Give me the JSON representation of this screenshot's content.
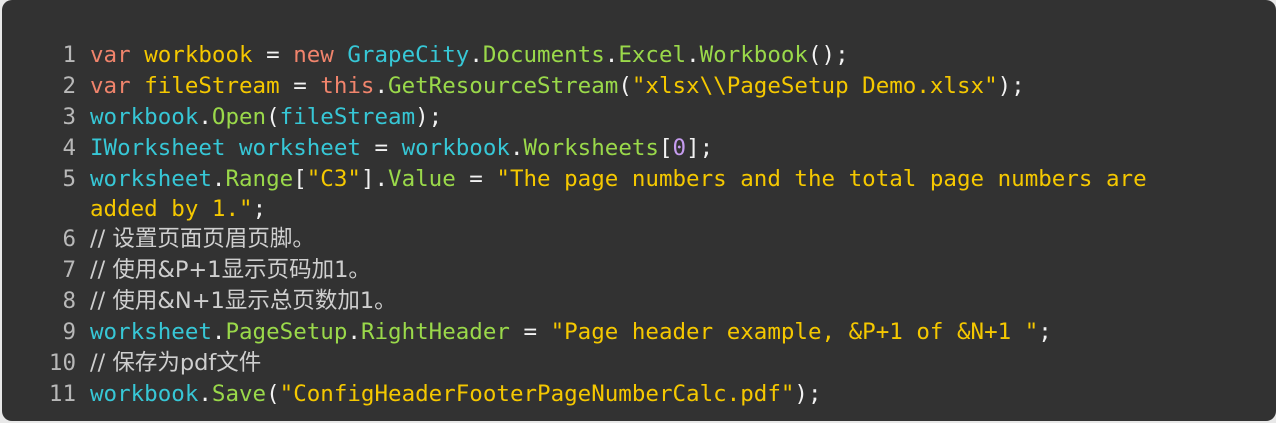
{
  "code": {
    "line_numbers": [
      "1",
      "2",
      "3",
      "4",
      "5",
      "6",
      "7",
      "8",
      "9",
      "10",
      "11"
    ],
    "lines": [
      [
        {
          "t": "k",
          "v": "var"
        },
        {
          "t": "p",
          "v": " "
        },
        {
          "t": "v",
          "v": "workbook"
        },
        {
          "t": "p",
          "v": " = "
        },
        {
          "t": "k",
          "v": "new"
        },
        {
          "t": "p",
          "v": " "
        },
        {
          "t": "c",
          "v": "GrapeCity"
        },
        {
          "t": "p",
          "v": "."
        },
        {
          "t": "m",
          "v": "Documents"
        },
        {
          "t": "p",
          "v": "."
        },
        {
          "t": "m",
          "v": "Excel"
        },
        {
          "t": "p",
          "v": "."
        },
        {
          "t": "m",
          "v": "Workbook"
        },
        {
          "t": "p",
          "v": "();"
        }
      ],
      [
        {
          "t": "k",
          "v": "var"
        },
        {
          "t": "p",
          "v": " "
        },
        {
          "t": "v",
          "v": "fileStream"
        },
        {
          "t": "p",
          "v": " = "
        },
        {
          "t": "k",
          "v": "this"
        },
        {
          "t": "p",
          "v": "."
        },
        {
          "t": "m",
          "v": "GetResourceStream"
        },
        {
          "t": "p",
          "v": "("
        },
        {
          "t": "s",
          "v": "\"xlsx\\\\PageSetup Demo.xlsx\""
        },
        {
          "t": "p",
          "v": ");"
        }
      ],
      [
        {
          "t": "c",
          "v": "workbook"
        },
        {
          "t": "p",
          "v": "."
        },
        {
          "t": "m",
          "v": "Open"
        },
        {
          "t": "p",
          "v": "("
        },
        {
          "t": "c",
          "v": "fileStream"
        },
        {
          "t": "p",
          "v": ");"
        }
      ],
      [
        {
          "t": "c",
          "v": "IWorksheet"
        },
        {
          "t": "p",
          "v": " "
        },
        {
          "t": "c",
          "v": "worksheet"
        },
        {
          "t": "p",
          "v": " = "
        },
        {
          "t": "c",
          "v": "workbook"
        },
        {
          "t": "p",
          "v": "."
        },
        {
          "t": "m",
          "v": "Worksheets"
        },
        {
          "t": "p",
          "v": "["
        },
        {
          "t": "n",
          "v": "0"
        },
        {
          "t": "p",
          "v": "];"
        }
      ],
      [
        {
          "t": "c",
          "v": "worksheet"
        },
        {
          "t": "p",
          "v": "."
        },
        {
          "t": "m",
          "v": "Range"
        },
        {
          "t": "p",
          "v": "["
        },
        {
          "t": "s",
          "v": "\"C3\""
        },
        {
          "t": "p",
          "v": "]."
        },
        {
          "t": "m",
          "v": "Value"
        },
        {
          "t": "p",
          "v": " = "
        },
        {
          "t": "s",
          "v": "\"The page numbers and the total page numbers are added by 1.\""
        },
        {
          "t": "p",
          "v": ";"
        }
      ],
      [
        {
          "t": "cm",
          "v": "// 设置页面页眉页脚。"
        }
      ],
      [
        {
          "t": "cm",
          "v": "// 使用&P+1显示页码加1。"
        }
      ],
      [
        {
          "t": "cm",
          "v": "// 使用&N+1显示总页数加1。"
        }
      ],
      [
        {
          "t": "c",
          "v": "worksheet"
        },
        {
          "t": "p",
          "v": "."
        },
        {
          "t": "m",
          "v": "PageSetup"
        },
        {
          "t": "p",
          "v": "."
        },
        {
          "t": "m",
          "v": "RightHeader"
        },
        {
          "t": "p",
          "v": " = "
        },
        {
          "t": "s",
          "v": "\"Page header example, &P+1 of &N+1 \""
        },
        {
          "t": "p",
          "v": ";"
        }
      ],
      [
        {
          "t": "cm",
          "v": "// 保存为pdf文件"
        }
      ],
      [
        {
          "t": "c",
          "v": "workbook"
        },
        {
          "t": "p",
          "v": "."
        },
        {
          "t": "m",
          "v": "Save"
        },
        {
          "t": "p",
          "v": "("
        },
        {
          "t": "s",
          "v": "\"ConfigHeaderFooterPageNumberCalc.pdf\""
        },
        {
          "t": "p",
          "v": ");"
        }
      ]
    ]
  }
}
